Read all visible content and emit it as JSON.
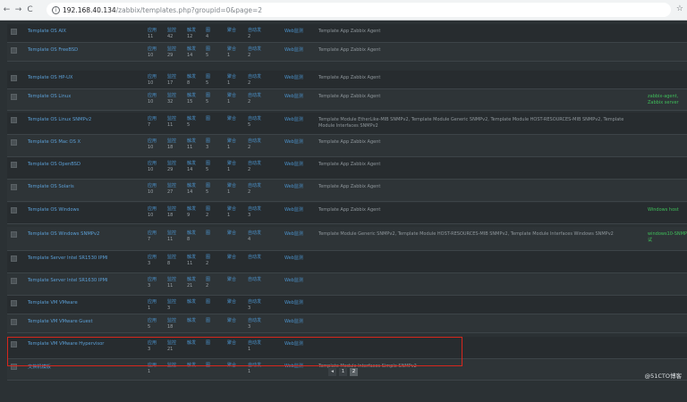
{
  "browser": {
    "url_host": "192.168.40.134",
    "url_path": "/zabbix/templates.php?groupid=0&page=2"
  },
  "labels": {
    "apps": "应用",
    "items": "监控项",
    "items_short": "监控",
    "items_abbr": "项",
    "triggers": "触发",
    "triggers_abbr": "器",
    "graphs": "图",
    "graphs_abbr": "形",
    "screens": "聚合",
    "screens_abbr": "图",
    "discovery": "自动发",
    "discovery_abbr": "现",
    "web": "Web监测"
  },
  "rows": [
    {
      "name": "Template OS AIX",
      "c": [
        "11",
        "42",
        "12",
        "4",
        "",
        "2"
      ],
      "templates": "Template App Zabbix Agent",
      "right": ""
    },
    {
      "name": "Template OS FreeBSD",
      "c": [
        "10",
        "29",
        "14",
        "5",
        "1",
        "2"
      ],
      "templates": "Template App Zabbix Agent",
      "right": ""
    },
    {
      "name": "Template OS HP-UX",
      "c": [
        "10",
        "17",
        "8",
        "5",
        "1",
        "2"
      ],
      "templates": "Template App Zabbix Agent",
      "right": ""
    },
    {
      "name": "Template OS Linux",
      "c": [
        "10",
        "32",
        "15",
        "5",
        "1",
        "2"
      ],
      "templates": "Template App Zabbix Agent",
      "right": "zabbix-agent, Zabbix server"
    },
    {
      "name": "Template OS Linux SNMPv2",
      "c": [
        "7",
        "11",
        "5",
        "",
        "",
        "5"
      ],
      "templates": "Template Module EtherLike-MIB SNMPv2, Template Module Generic SNMPv2, Template Module HOST-RESOURCES-MIB SNMPv2, Template Module Interfaces SNMPv2",
      "right": ""
    },
    {
      "name": "Template OS Mac OS X",
      "c": [
        "10",
        "18",
        "11",
        "3",
        "1",
        "2"
      ],
      "templates": "Template App Zabbix Agent",
      "right": ""
    },
    {
      "name": "Template OS OpenBSD",
      "c": [
        "10",
        "29",
        "14",
        "5",
        "1",
        "2"
      ],
      "templates": "Template App Zabbix Agent",
      "right": ""
    },
    {
      "name": "Template OS Solaris",
      "c": [
        "10",
        "27",
        "14",
        "5",
        "1",
        "2"
      ],
      "templates": "Template App Zabbix Agent",
      "right": ""
    },
    {
      "name": "Template OS Windows",
      "c": [
        "10",
        "18",
        "9",
        "2",
        "1",
        "3"
      ],
      "templates": "Template App Zabbix Agent",
      "right": "Windows host"
    },
    {
      "name": "Template OS Windows SNMPv2",
      "c": [
        "7",
        "11",
        "8",
        "",
        "",
        "4"
      ],
      "templates": "Template Module Generic SNMPv2, Template Module HOST-RESOURCES-MIB SNMPv2, Template Module Interfaces Windows SNMPv2",
      "right": "windows10-SNMP测试"
    },
    {
      "name": "Template Server Intel SR1530 IPMI",
      "c": [
        "3",
        "8",
        "11",
        "2",
        "",
        ""
      ],
      "templates": "",
      "right": ""
    },
    {
      "name": "Template Server Intel SR1630 IPMI",
      "c": [
        "3",
        "11",
        "21",
        "2",
        "",
        ""
      ],
      "templates": "",
      "right": ""
    },
    {
      "name": "Template VM VMware",
      "c": [
        "1",
        "3",
        "",
        "",
        "",
        "3"
      ],
      "templates": "",
      "right": ""
    },
    {
      "name": "Template VM VMware Guest",
      "c": [
        "5",
        "18",
        "",
        "",
        "",
        "3"
      ],
      "templates": "",
      "right": ""
    },
    {
      "name": "Template VM VMware Hypervisor",
      "c": [
        "3",
        "21",
        "",
        "",
        "",
        "1"
      ],
      "templates": "",
      "right": ""
    },
    {
      "name": "交换机模板",
      "c": [
        "1",
        "",
        "",
        "",
        "",
        "1"
      ],
      "templates": "Template Module Interfaces Simple SNMPv2",
      "right": ""
    }
  ],
  "pager": {
    "prev": "◂",
    "pages": [
      "1",
      "2"
    ],
    "active": "2"
  },
  "watermark": "@51CTO博客"
}
